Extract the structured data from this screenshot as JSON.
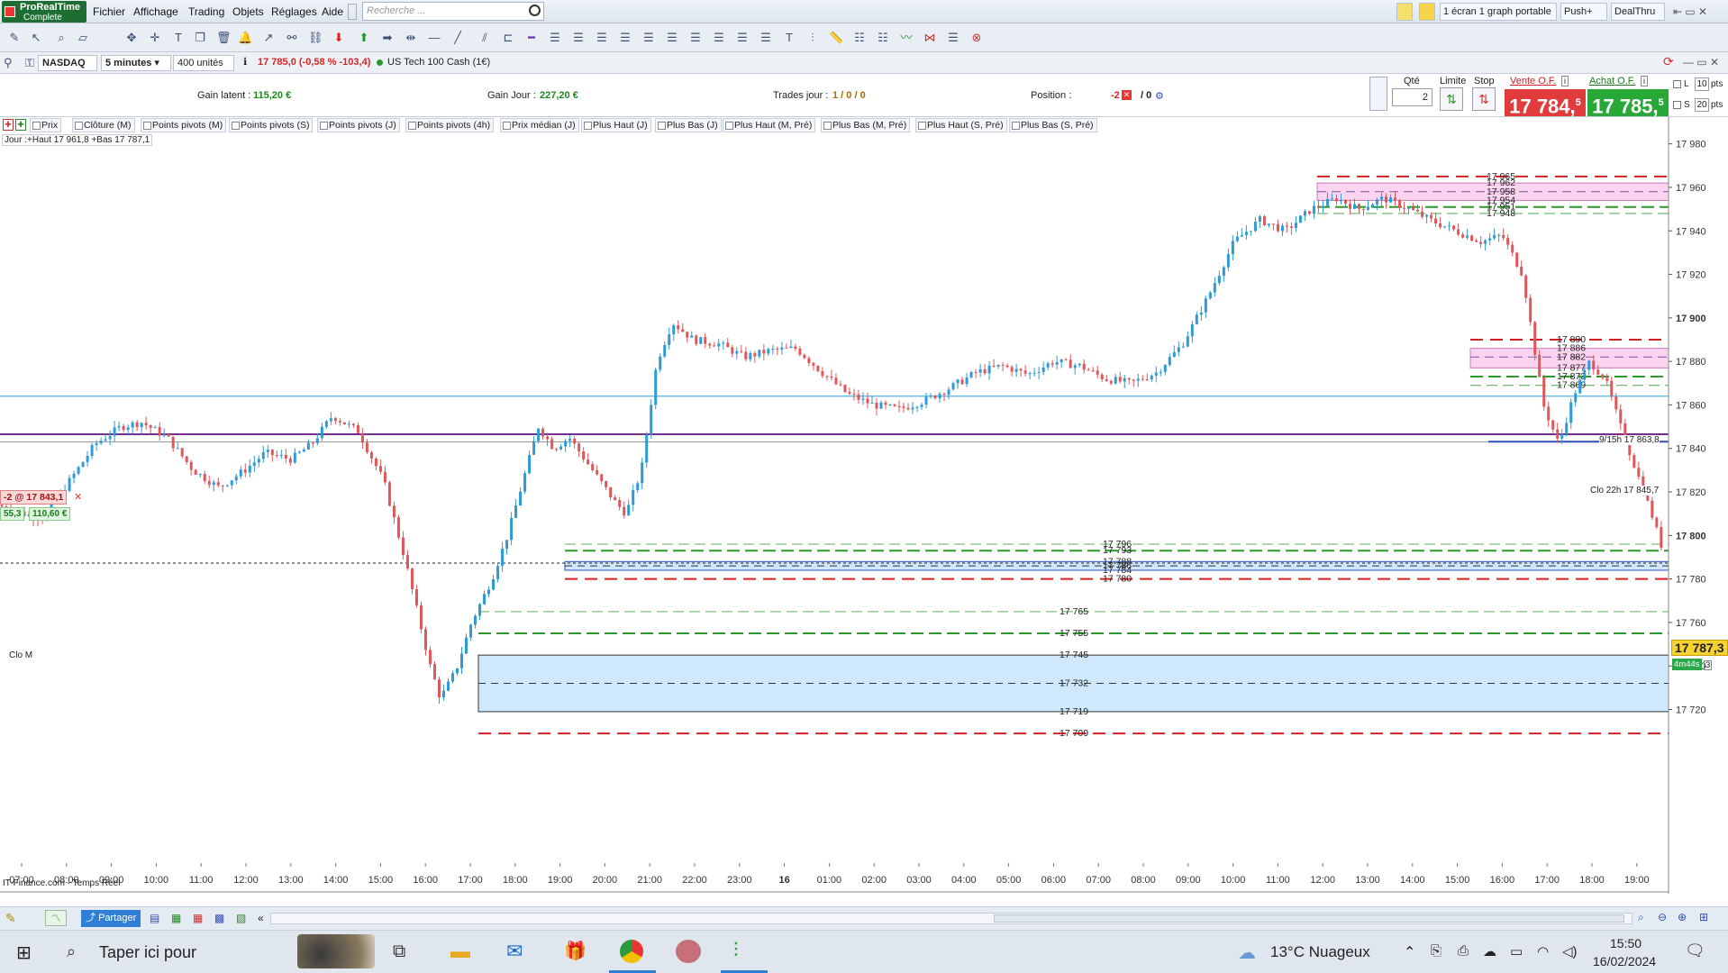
{
  "app": {
    "name_line1": "ProRealTime",
    "name_line2": "Complete"
  },
  "menu": [
    "Fichier",
    "Affichage",
    "Trading",
    "Objets",
    "Réglages",
    "Aide"
  ],
  "search": {
    "placeholder": "Recherche ..."
  },
  "top_right": {
    "layout": "1 écran 1 graph portable",
    "push": "Push+",
    "dealthru": "DealThru"
  },
  "chart_header": {
    "instrument": "NASDAQ",
    "timeframe": "5 minutes",
    "units": "400 unités",
    "quote": "17 785,0 (-0,58 % -103,4)",
    "name": "US Tech 100 Cash (1€)"
  },
  "info": {
    "gain_latent_label": "Gain latent :",
    "gain_latent_value": "115,20 €",
    "gain_jour_label": "Gain Jour :",
    "gain_jour_value": "227,20 €",
    "trades_label": "Trades jour :",
    "trades_value": "1 / 0 / 0",
    "position_label": "Position :",
    "position_value": "-2",
    "position_zero": "/ 0"
  },
  "order_panel": {
    "qty_label": "Qté",
    "qty_value": "2",
    "limit_label": "Limite",
    "stop_label": "Stop",
    "sell_label": "Vente O.F.",
    "buy_label": "Achat O.F.",
    "sell_price": "17 784,",
    "sell_sup": "5",
    "buy_price": "17 785,",
    "buy_sup": "5",
    "l_label": "L",
    "s_label": "S",
    "l_pts": "10",
    "s_pts": "20",
    "pts": "pts",
    "pts2": "pts"
  },
  "indicators": [
    "Prix",
    "Clôture (M)",
    "Points pivots (M)",
    "Points pivots (S)",
    "Points pivots (J)",
    "Points pivots (4h)",
    "Prix médian (J)",
    "Plus Haut (J)",
    "Plus Bas (J)",
    "Plus Haut (M, Pré)",
    "Plus Bas (M, Pré)",
    "Plus Haut (S, Pré)",
    "Plus Bas (S, Pré)"
  ],
  "chart_labels": {
    "day_info": "Jour :+Haut 17 961,8 +Bas 17 787,1",
    "position_tag": "-2 @ 17 843,1",
    "pos_a": "55,3",
    "pos_b": "110,60 €",
    "clo_m": "Clo M",
    "clo22": "Clo 22h 17 845,7",
    "ninefifteen": "9/15h 17 863,8",
    "source": "IT-Finance.com - Temps Réel",
    "last_price": "17 787,3",
    "countdown": "4m44s",
    "countdown_n": "3"
  },
  "chart_data": {
    "type": "candlestick",
    "y_ticks": [
      "17 980",
      "17 960",
      "17 940",
      "17 920",
      "17 900",
      "17 880",
      "17 860",
      "17 840",
      "17 820",
      "17 800",
      "17 780",
      "17 760",
      "17 740",
      "17 720"
    ],
    "x_ticks": [
      "07:00",
      "08:00",
      "09:00",
      "10:00",
      "11:00",
      "12:00",
      "13:00",
      "14:00",
      "15:00",
      "16:00",
      "17:00",
      "18:00",
      "19:00",
      "20:00",
      "21:00",
      "22:00",
      "23:00",
      "16",
      "01:00",
      "02:00",
      "03:00",
      "04:00",
      "05:00",
      "06:00",
      "07:00",
      "08:00",
      "09:00",
      "10:00",
      "11:00",
      "12:00",
      "13:00",
      "14:00",
      "15:00",
      "16:00",
      "17:00",
      "18:00",
      "19:00"
    ],
    "ylim": [
      17714,
      17984
    ],
    "path": [
      [
        0,
        17814
      ],
      [
        10,
        17810
      ],
      [
        18,
        17808
      ],
      [
        28,
        17825
      ],
      [
        38,
        17842
      ],
      [
        48,
        17850
      ],
      [
        56,
        17852
      ],
      [
        66,
        17845
      ],
      [
        76,
        17830
      ],
      [
        86,
        17822
      ],
      [
        96,
        17830
      ],
      [
        104,
        17838
      ],
      [
        114,
        17835
      ],
      [
        122,
        17842
      ],
      [
        130,
        17855
      ],
      [
        140,
        17848
      ],
      [
        150,
        17825
      ],
      [
        158,
        17790
      ],
      [
        164,
        17760
      ],
      [
        168,
        17740
      ],
      [
        172,
        17725
      ],
      [
        178,
        17738
      ],
      [
        184,
        17760
      ],
      [
        192,
        17780
      ],
      [
        198,
        17800
      ],
      [
        204,
        17825
      ],
      [
        210,
        17850
      ],
      [
        216,
        17840
      ],
      [
        222,
        17845
      ],
      [
        228,
        17835
      ],
      [
        234,
        17825
      ],
      [
        240,
        17815
      ],
      [
        244,
        17810
      ],
      [
        250,
        17830
      ],
      [
        256,
        17880
      ],
      [
        262,
        17898
      ],
      [
        270,
        17890
      ],
      [
        280,
        17888
      ],
      [
        290,
        17882
      ],
      [
        300,
        17885
      ],
      [
        310,
        17886
      ],
      [
        320,
        17875
      ],
      [
        330,
        17865
      ],
      [
        340,
        17860
      ],
      [
        350,
        17858
      ],
      [
        360,
        17862
      ],
      [
        370,
        17868
      ],
      [
        380,
        17875
      ],
      [
        390,
        17878
      ],
      [
        400,
        17874
      ],
      [
        410,
        17880
      ],
      [
        420,
        17878
      ],
      [
        430,
        17872
      ],
      [
        440,
        17870
      ],
      [
        450,
        17875
      ],
      [
        460,
        17888
      ],
      [
        470,
        17910
      ],
      [
        480,
        17935
      ],
      [
        490,
        17945
      ],
      [
        500,
        17940
      ],
      [
        510,
        17950
      ],
      [
        520,
        17955
      ],
      [
        528,
        17950
      ],
      [
        538,
        17955
      ],
      [
        548,
        17950
      ],
      [
        556,
        17945
      ],
      [
        566,
        17940
      ],
      [
        576,
        17935
      ],
      [
        584,
        17938
      ],
      [
        592,
        17920
      ],
      [
        600,
        17860
      ],
      [
        606,
        17842
      ],
      [
        612,
        17865
      ],
      [
        618,
        17880
      ],
      [
        624,
        17872
      ],
      [
        630,
        17850
      ],
      [
        636,
        17830
      ],
      [
        642,
        17810
      ],
      [
        648,
        17787
      ]
    ],
    "levels": [
      {
        "price": 17965,
        "label": "17 965",
        "style": "red-long"
      },
      {
        "price": 17962,
        "label": "17 962",
        "style": "none"
      },
      {
        "price": 17958,
        "label": "17 958",
        "style": "purple"
      },
      {
        "price": 17954,
        "label": "17 954",
        "style": "none"
      },
      {
        "price": 17951,
        "label": "17 951",
        "style": "green"
      },
      {
        "price": 17948,
        "label": "17 948",
        "style": "green-light"
      },
      {
        "price": 17890,
        "label": "17 890",
        "style": "red-long"
      },
      {
        "price": 17886,
        "label": "17 886",
        "style": "none"
      },
      {
        "price": 17882,
        "label": "17 882",
        "style": "purple"
      },
      {
        "price": 17877,
        "label": "17 877",
        "style": "none"
      },
      {
        "price": 17873,
        "label": "17 873",
        "style": "green"
      },
      {
        "price": 17869,
        "label": "17 869",
        "style": "green-light"
      },
      {
        "price": 17796,
        "label": "17 796",
        "style": "green-light"
      },
      {
        "price": 17793,
        "label": "17 793",
        "style": "green"
      },
      {
        "price": 17788,
        "label": "17 788",
        "style": "none"
      },
      {
        "price": 17786,
        "label": "17 786",
        "style": "blue"
      },
      {
        "price": 17784,
        "label": "17 784",
        "style": "none"
      },
      {
        "price": 17780,
        "label": "17 780",
        "style": "red-long"
      },
      {
        "price": 17765,
        "label": "17 765",
        "style": "green-light"
      },
      {
        "price": 17755,
        "label": "17 755",
        "style": "green"
      },
      {
        "price": 17745,
        "label": "17 745",
        "style": "none"
      },
      {
        "price": 17732,
        "label": "17 732",
        "style": "blue"
      },
      {
        "price": 17719,
        "label": "17 719",
        "style": "none"
      },
      {
        "price": 17709,
        "label": "17 709",
        "style": "red-long"
      }
    ],
    "colors": {
      "up": "#2e9ad6",
      "down": "#e0565b",
      "red_dash": "#d42020",
      "green_dash": "#2b9a2b",
      "purple_line": "#7a2c8f",
      "blue_line": "#2f4fb5",
      "cyan_line": "#4fb4e0"
    }
  },
  "bottom": {
    "share": "Partager"
  },
  "taskbar": {
    "search": "Taper ici pour",
    "weather": "13°C  Nuageux",
    "time": "15:50",
    "date": "16/02/2024"
  }
}
